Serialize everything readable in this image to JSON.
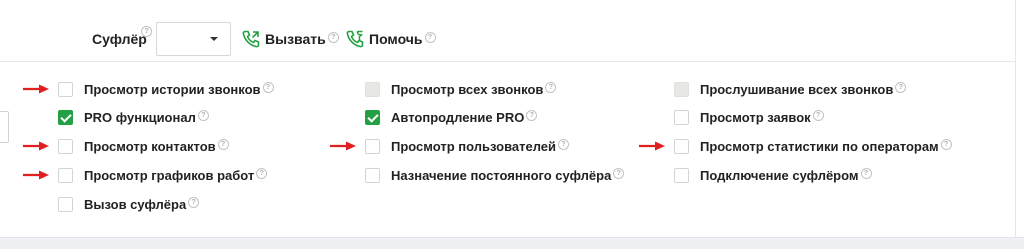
{
  "toolbar": {
    "prompter_label": "Суфлёр",
    "select_value": "",
    "call_label": "Вызвать",
    "help_label": "Помочь"
  },
  "help_glyph": "?",
  "accent_color": "#23a043",
  "marker_color": "#e02020",
  "permissions": {
    "col1": [
      {
        "label": "Просмотр истории звонков",
        "state": "unchecked",
        "marked": true
      },
      {
        "label": "PRO функционал",
        "state": "checked",
        "marked": false
      },
      {
        "label": "Просмотр контактов",
        "state": "unchecked",
        "marked": true
      },
      {
        "label": "Просмотр графиков работ",
        "state": "unchecked",
        "marked": true
      },
      {
        "label": "Вызов суфлёра",
        "state": "unchecked",
        "marked": false
      }
    ],
    "col2": [
      {
        "label": "Просмотр всех звонков",
        "state": "disabled",
        "marked": false
      },
      {
        "label": "Автопродление PRO",
        "state": "checked",
        "marked": false
      },
      {
        "label": "Просмотр пользователей",
        "state": "unchecked",
        "marked": true
      },
      {
        "label": "Назначение постоянного суфлёра",
        "state": "unchecked",
        "marked": false
      }
    ],
    "col3": [
      {
        "label": "Прослушивание всех звонков",
        "state": "disabled",
        "marked": false
      },
      {
        "label": "Просмотр заявок",
        "state": "unchecked",
        "marked": false
      },
      {
        "label": "Просмотр статистики по операторам",
        "state": "unchecked",
        "marked": true
      },
      {
        "label": "Подключение суфлёром",
        "state": "unchecked",
        "marked": false
      }
    ]
  }
}
